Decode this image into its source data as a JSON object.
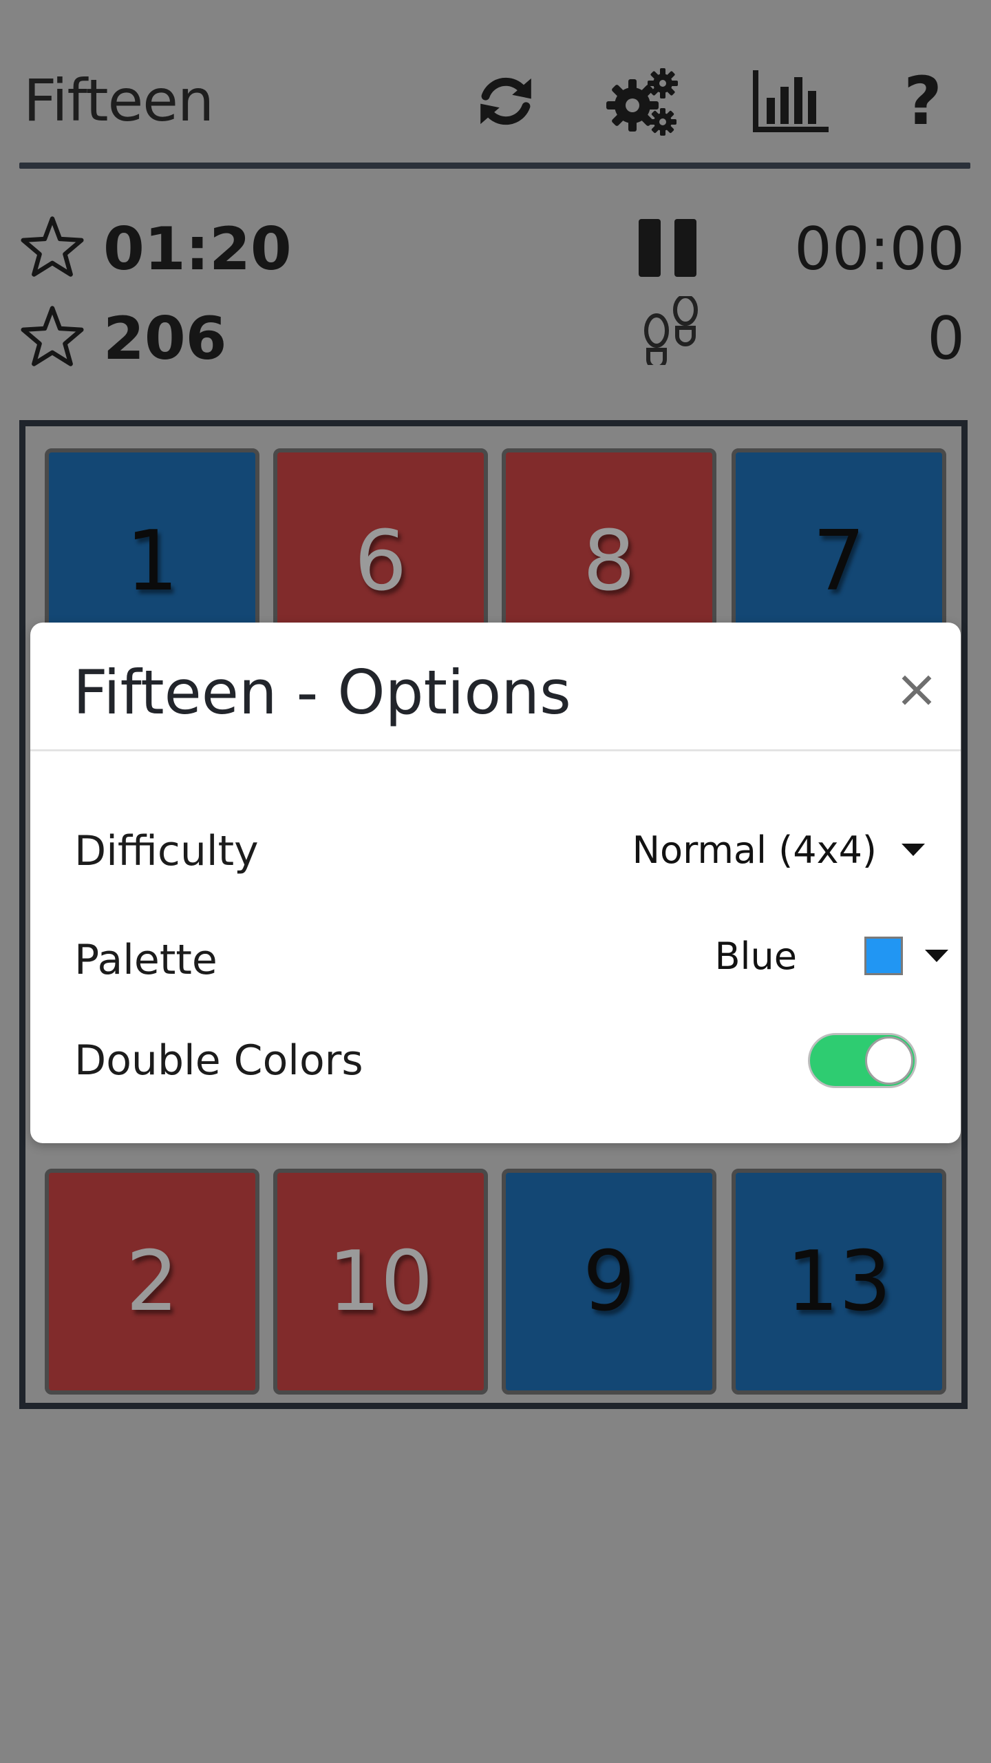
{
  "header": {
    "title": "Fifteen",
    "icons": [
      "refresh-icon",
      "gear-icon",
      "chart-icon",
      "help-icon"
    ],
    "help_label": "?"
  },
  "stats": {
    "best_time": "01:20",
    "best_moves": "206",
    "current_time": "00:00",
    "current_moves": "0"
  },
  "board": {
    "tiles": [
      {
        "label": "1",
        "color": "blue"
      },
      {
        "label": "6",
        "color": "red"
      },
      {
        "label": "8",
        "color": "red"
      },
      {
        "label": "7",
        "color": "blue"
      },
      {
        "label": "2",
        "color": "red"
      },
      {
        "label": "10",
        "color": "red"
      },
      {
        "label": "9",
        "color": "blue"
      },
      {
        "label": "13",
        "color": "blue"
      }
    ]
  },
  "dialog": {
    "title": "Fifteen - Options",
    "close_label": "×",
    "difficulty_label": "Difficulty",
    "difficulty_value": "Normal (4x4)",
    "palette_label": "Palette",
    "palette_value": "Blue",
    "palette_swatch": "#2196f3",
    "double_colors_label": "Double Colors",
    "double_colors_on": true
  },
  "colors": {
    "background": "#848484",
    "tile_blue": "#134774",
    "tile_red": "#812b2b",
    "toggle_on": "#2ecc71"
  }
}
